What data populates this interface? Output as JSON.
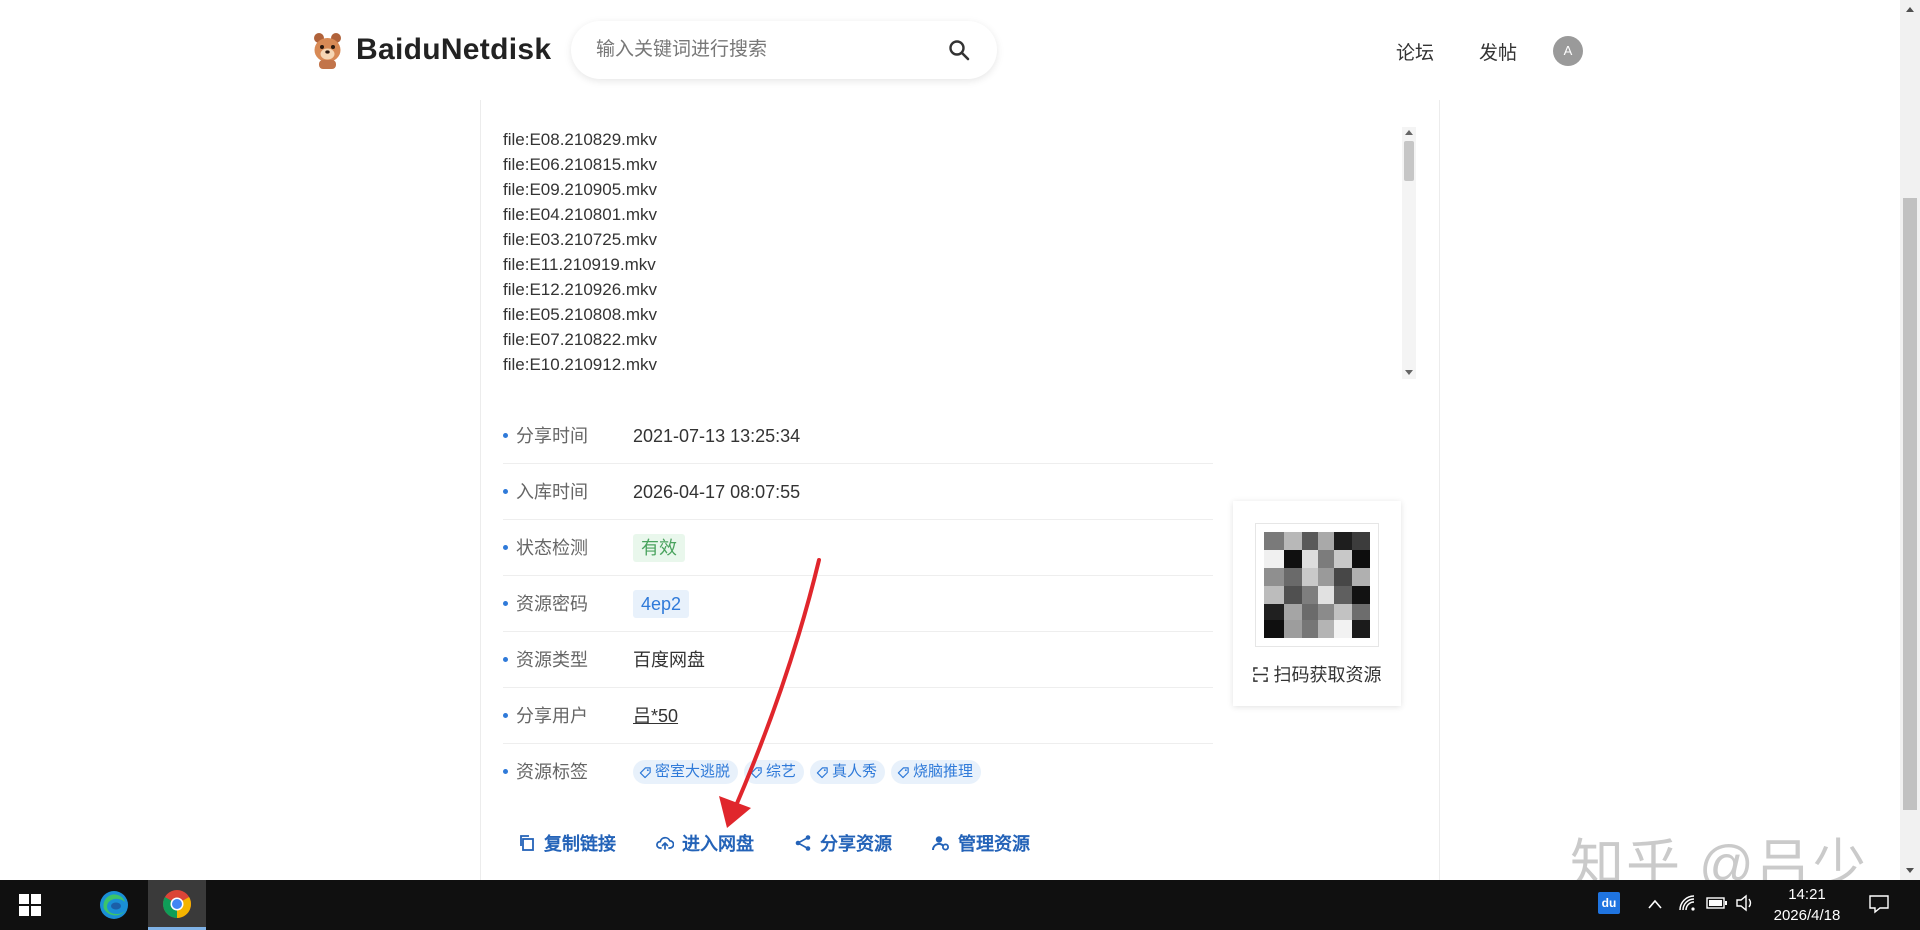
{
  "header": {
    "logo_text": "BaiduNetdisk",
    "search_placeholder": "输入关键词进行搜索",
    "nav": [
      "论坛",
      "发帖"
    ],
    "avatar_letter": "A"
  },
  "files": [
    "file:E08.210829.mkv",
    "file:E06.210815.mkv",
    "file:E09.210905.mkv",
    "file:E04.210801.mkv",
    "file:E03.210725.mkv",
    "file:E11.210919.mkv",
    "file:E12.210926.mkv",
    "file:E05.210808.mkv",
    "file:E07.210822.mkv",
    "file:E10.210912.mkv"
  ],
  "info": {
    "share_time_label": "分享时间",
    "share_time": "2021-07-13 13:25:34",
    "index_time_label": "入库时间",
    "index_time": "2026-04-17 08:07:55",
    "status_label": "状态检测",
    "status": "有效",
    "password_label": "资源密码",
    "password": "4ep2",
    "type_label": "资源类型",
    "type": "百度网盘",
    "user_label": "分享用户",
    "user": "吕*50",
    "tags_label": "资源标签",
    "tags": [
      "密室大逃脱",
      "综艺",
      "真人秀",
      "烧脑推理"
    ]
  },
  "actions": {
    "copy": "复制链接",
    "enter": "进入网盘",
    "share": "分享资源",
    "manage": "管理资源"
  },
  "qr": {
    "caption": "扫码获取资源"
  },
  "watermark": "知乎 @吕少",
  "taskbar": {
    "time": "14:21",
    "date": "2026/4/18",
    "tray_badge": "du"
  },
  "colors": {
    "accent": "#2f7ad9",
    "action": "#2463b8",
    "valid_green": "#4aa35e",
    "arrow_red": "#e0262c"
  }
}
